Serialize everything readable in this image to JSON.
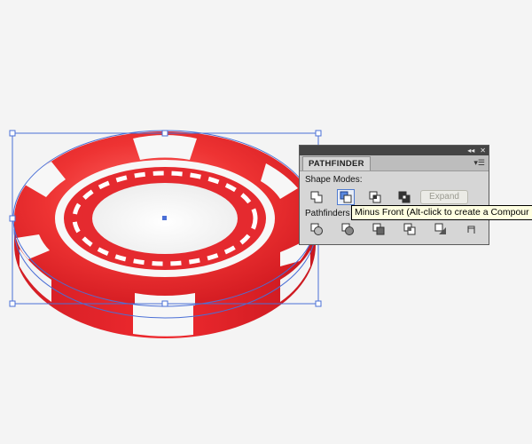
{
  "pathfinder_panel": {
    "tab_label": "PATHFINDER",
    "collapse_glyph": "◂◂",
    "close_glyph": "✕",
    "menu_glyph": "▾☰",
    "shape_modes_label": "Shape Modes:",
    "pathfinders_label": "Pathfinders",
    "expand_label": "Expand",
    "shape_mode_buttons": [
      "unite-icon",
      "minus-front-icon",
      "intersect-icon",
      "exclude-icon"
    ],
    "pathfinder_buttons": [
      "divide-icon",
      "trim-icon",
      "merge-icon",
      "crop-icon",
      "outline-icon",
      "minus-back-icon"
    ]
  },
  "tooltip": {
    "text": "Minus Front (Alt-click to create a Compour"
  },
  "colors": {
    "chip_red": "#e3232a",
    "chip_white": "#f7f7f7",
    "selection_blue": "#4a6fd6",
    "tooltip_bg": "#ffffe1"
  }
}
